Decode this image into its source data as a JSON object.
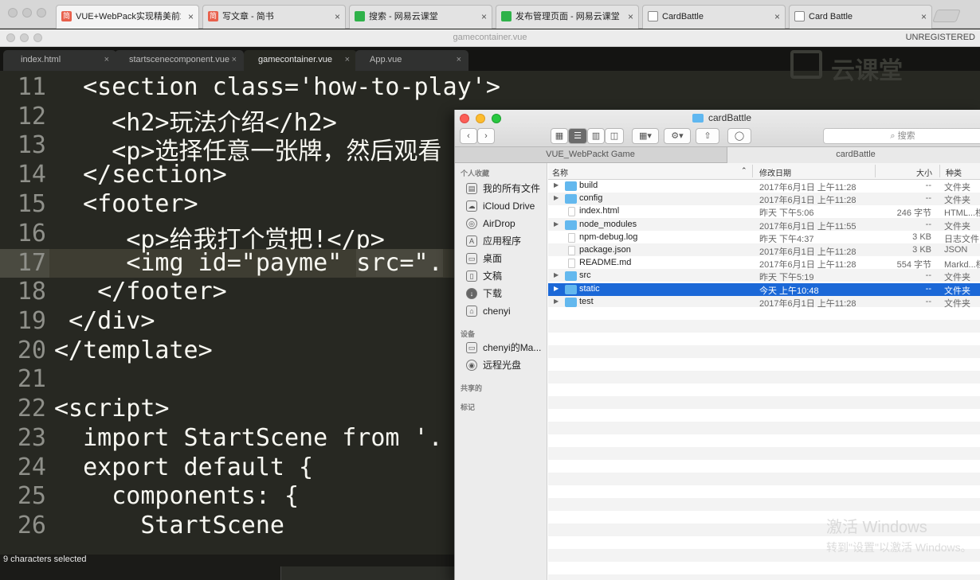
{
  "browser": {
    "tabs": [
      {
        "label": "VUE+WebPack实现精美前端",
        "favicon": "简",
        "favicon_color": "#e8604c",
        "active": true
      },
      {
        "label": "写文章 - 简书",
        "favicon": "简",
        "favicon_color": "#e8604c",
        "active": false
      },
      {
        "label": "搜索 - 网易云课堂",
        "favicon": "",
        "favicon_color": "#2fb24a",
        "active": false
      },
      {
        "label": "发布管理页面 - 网易云课堂",
        "favicon": "",
        "favicon_color": "#2fb24a",
        "active": false
      },
      {
        "label": "CardBattle",
        "favicon": "",
        "favicon_color": "#ffffff",
        "active": false
      },
      {
        "label": "Card Battle",
        "favicon": "",
        "favicon_color": "#ffffff",
        "active": false
      }
    ],
    "close_glyph": "×"
  },
  "editor": {
    "window_title": "gamecontainer.vue",
    "unregistered": "UNREGISTERED",
    "tabs": [
      {
        "label": "index.html",
        "active": false
      },
      {
        "label": "startscenecomponent.vue",
        "active": false
      },
      {
        "label": "gamecontainer.vue",
        "active": true
      },
      {
        "label": "App.vue",
        "active": false
      }
    ],
    "tab_close": "×",
    "watermark": "云课堂",
    "lines": [
      {
        "num": "11",
        "pre": "  ",
        "text": "<section class='how-to-play'>"
      },
      {
        "num": "12",
        "pre": "    ",
        "text": "<h2>玩法介绍</h2>"
      },
      {
        "num": "13",
        "pre": "    ",
        "text": "<p>选择任意一张牌，然后观看"
      },
      {
        "num": "14",
        "pre": "  ",
        "text": "</section>"
      },
      {
        "num": "15",
        "pre": "  ",
        "text": "<footer>"
      },
      {
        "num": "16",
        "pre": "     ",
        "text": "<p>给我打个赏把!</p>"
      },
      {
        "num": "17",
        "pre": "     ",
        "text": "<img id=\"payme\" ",
        "sel": "src=\"."
      },
      {
        "num": "18",
        "pre": "   ",
        "text": "</footer>"
      },
      {
        "num": "19",
        "pre": " ",
        "text": "</div>"
      },
      {
        "num": "20",
        "pre": "",
        "text": "</template>"
      },
      {
        "num": "21",
        "pre": "",
        "text": ""
      },
      {
        "num": "22",
        "pre": "",
        "text": "<script>"
      },
      {
        "num": "23",
        "pre": "  ",
        "text": "import StartScene from '."
      },
      {
        "num": "24",
        "pre": "  ",
        "text": "export default {"
      },
      {
        "num": "25",
        "pre": "    ",
        "text": "components: {"
      },
      {
        "num": "26",
        "pre": "      ",
        "text": "StartScene"
      }
    ],
    "status": "9 characters selected"
  },
  "windows_watermark": {
    "line1": "激活 Windows",
    "line2": "转到\"设置\"以激活 Windows。"
  },
  "finder": {
    "title": "cardBattle",
    "search_placeholder": "搜索",
    "view_icons": [
      "grid-icon",
      "list-icon",
      "column-icon",
      "gallery-icon"
    ],
    "tabs": [
      "VUE_WebPackt Game",
      "cardBattle"
    ],
    "sidebar": {
      "favorites_header": "个人收藏",
      "favorites": [
        {
          "label": "我的所有文件",
          "icon": "all-files-icon"
        },
        {
          "label": "iCloud Drive",
          "icon": "cloud-icon"
        },
        {
          "label": "AirDrop",
          "icon": "airdrop-icon"
        },
        {
          "label": "应用程序",
          "icon": "applications-icon"
        },
        {
          "label": "桌面",
          "icon": "desktop-icon"
        },
        {
          "label": "文稿",
          "icon": "documents-icon"
        },
        {
          "label": "下载",
          "icon": "downloads-icon"
        },
        {
          "label": "chenyi",
          "icon": "home-icon"
        }
      ],
      "devices_header": "设备",
      "devices": [
        {
          "label": "chenyi的Ma...",
          "icon": "laptop-icon"
        },
        {
          "label": "远程光盘",
          "icon": "disc-icon"
        }
      ],
      "shared_header": "共享的",
      "tags_header": "标记"
    },
    "columns": {
      "name": "名称",
      "date": "修改日期",
      "size": "大小",
      "kind": "种类"
    },
    "rows": [
      {
        "name": "build",
        "date": "2017年6月1日 上午11:28",
        "size": "--",
        "kind": "文件夹",
        "type": "folder",
        "expandable": true
      },
      {
        "name": "config",
        "date": "2017年6月1日 上午11:28",
        "size": "--",
        "kind": "文件夹",
        "type": "folder",
        "expandable": true
      },
      {
        "name": "index.html",
        "date": "昨天 下午5:06",
        "size": "246 字节",
        "kind": "HTML...档",
        "type": "html",
        "expandable": false
      },
      {
        "name": "node_modules",
        "date": "2017年6月1日 上午11:55",
        "size": "--",
        "kind": "文件夹",
        "type": "folder",
        "expandable": true
      },
      {
        "name": "npm-debug.log",
        "date": "昨天 下午4:37",
        "size": "3 KB",
        "kind": "日志文件",
        "type": "file",
        "expandable": false
      },
      {
        "name": "package.json",
        "date": "2017年6月1日 上午11:28",
        "size": "3 KB",
        "kind": "JSON",
        "type": "file",
        "expandable": false
      },
      {
        "name": "README.md",
        "date": "2017年6月1日 上午11:28",
        "size": "554 字节",
        "kind": "Markd...档",
        "type": "file",
        "expandable": false
      },
      {
        "name": "src",
        "date": "昨天 下午5:19",
        "size": "--",
        "kind": "文件夹",
        "type": "folder",
        "expandable": true
      },
      {
        "name": "static",
        "date": "今天 上午10:48",
        "size": "--",
        "kind": "文件夹",
        "type": "folder",
        "expandable": true,
        "selected": true
      },
      {
        "name": "test",
        "date": "2017年6月1日 上午11:28",
        "size": "--",
        "kind": "文件夹",
        "type": "folder",
        "expandable": true
      }
    ],
    "selected_color": "#1b68d7"
  }
}
